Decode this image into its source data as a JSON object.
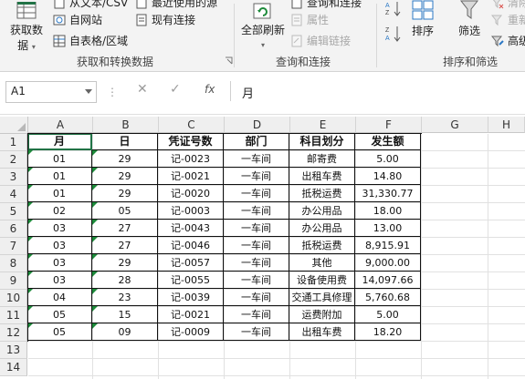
{
  "ribbon": {
    "get_data": {
      "line1": "获取数",
      "line2": "据"
    },
    "from_text_csv": "从文本/CSV",
    "from_web": "自网站",
    "from_table": "自表格/区域",
    "recent_sources": "最近使用的源",
    "existing_connections": "现有连接",
    "group_get_transform": "获取和转换数据",
    "refresh_all": "全部刷新",
    "queries_connections": "查询和连接",
    "properties": "属性",
    "edit_links": "编辑链接",
    "group_queries": "查询和连接",
    "sort": "排序",
    "filter": "筛选",
    "clear": "清除",
    "reapply": "重新",
    "advanced": "高级",
    "group_sort_filter": "排序和筛选"
  },
  "formula_bar": {
    "name_box": "A1",
    "fx_label": "fx",
    "content": "月"
  },
  "columns": [
    "A",
    "B",
    "C",
    "D",
    "E",
    "F",
    "G",
    "H"
  ],
  "rows": [
    "1",
    "2",
    "3",
    "4",
    "5",
    "6",
    "7",
    "8",
    "9",
    "10",
    "11",
    "12",
    "13",
    "14"
  ],
  "table": {
    "headers": [
      "月",
      "日",
      "凭证号数",
      "部门",
      "科目划分",
      "发生额"
    ],
    "records": [
      [
        "01",
        "29",
        "记-0023",
        "一车间",
        "邮寄费",
        "5.00"
      ],
      [
        "01",
        "29",
        "记-0021",
        "一车间",
        "出租车费",
        "14.80"
      ],
      [
        "01",
        "29",
        "记-0020",
        "一车间",
        "抵税运费",
        "31,330.77"
      ],
      [
        "02",
        "05",
        "记-0003",
        "一车间",
        "办公用品",
        "18.00"
      ],
      [
        "03",
        "27",
        "记-0043",
        "一车间",
        "办公用品",
        "13.00"
      ],
      [
        "03",
        "27",
        "记-0046",
        "一车间",
        "抵税运费",
        "8,915.91"
      ],
      [
        "03",
        "29",
        "记-0057",
        "一车间",
        "其他",
        "9,000.00"
      ],
      [
        "03",
        "28",
        "记-0055",
        "一车间",
        "设备使用费",
        "14,097.66"
      ],
      [
        "04",
        "23",
        "记-0039",
        "一车间",
        "交通工具修理",
        "5,760.68"
      ],
      [
        "05",
        "15",
        "记-0021",
        "一车间",
        "运费附加",
        "5.00"
      ],
      [
        "05",
        "09",
        "记-0009",
        "一车间",
        "出租车费",
        "18.20"
      ]
    ]
  },
  "colors": {
    "accent": "#217346",
    "error_triangle": "#1d8a3a"
  }
}
